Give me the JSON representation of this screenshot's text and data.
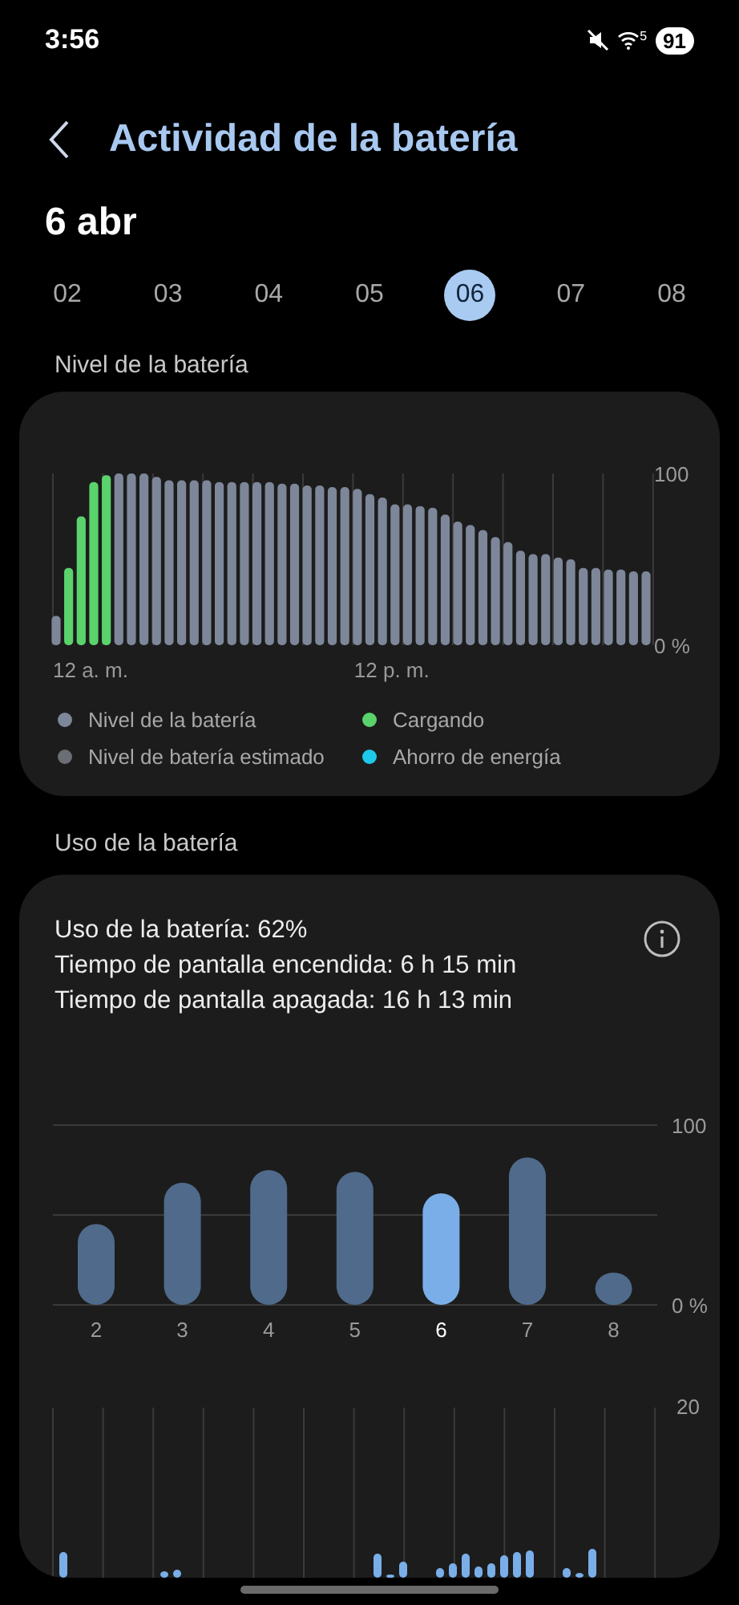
{
  "status_bar": {
    "time": "3:56",
    "wifi_label": "5",
    "battery": "91"
  },
  "header": {
    "title": "Actividad de la batería"
  },
  "date": "6 abr",
  "days": [
    {
      "label": "02",
      "selected": false
    },
    {
      "label": "03",
      "selected": false
    },
    {
      "label": "04",
      "selected": false
    },
    {
      "label": "05",
      "selected": false
    },
    {
      "label": "06",
      "selected": true
    },
    {
      "label": "07",
      "selected": false
    },
    {
      "label": "08",
      "selected": false
    }
  ],
  "level_section": {
    "title": "Nivel de la batería",
    "chart_data": {
      "type": "bar",
      "stacked": true,
      "series": [
        {
          "name": "Nivel de la batería",
          "color": "#7d8799",
          "values": [
            17,
            null,
            null,
            null,
            null,
            100,
            100,
            100,
            98,
            96,
            96,
            96,
            96,
            95,
            95,
            95,
            95,
            95,
            94,
            94,
            93,
            93,
            92,
            92,
            91,
            88,
            86,
            82,
            82,
            81,
            80,
            76,
            72,
            70,
            67,
            63,
            60,
            55,
            53,
            53,
            51,
            50,
            45,
            45,
            44,
            44,
            43,
            43
          ]
        },
        {
          "name": "Cargando",
          "color": "#5ad36c",
          "values": [
            null,
            45,
            75,
            95,
            99,
            null,
            null,
            null,
            null,
            null,
            null,
            null,
            null,
            null,
            null,
            null,
            null,
            null,
            null,
            null,
            null,
            null,
            null,
            null,
            null,
            null,
            null,
            null,
            null,
            null,
            null,
            null,
            null,
            null,
            null,
            null,
            null,
            null,
            null,
            null,
            null,
            null,
            null,
            null,
            null,
            null,
            null,
            null
          ]
        }
      ],
      "ylim": [
        0,
        100
      ],
      "yticks": [
        {
          "value": 100,
          "label": "100"
        },
        {
          "value": 0,
          "label": "0 %"
        }
      ]
    },
    "time_labels": [
      "12 a. m.",
      "12 p. m."
    ],
    "extra_legend": [
      {
        "label": "Nivel de batería estimado",
        "color": "#6b6e74"
      },
      {
        "label": "Ahorro de energía",
        "color": "#1ec8e8"
      }
    ]
  },
  "usage_section": {
    "title": "Uso de la batería",
    "summary": [
      "Uso de la batería: 62%",
      "Tiempo de pantalla encendida: 6 h 15 min",
      "Tiempo de pantalla apagada: 16 h 13 min"
    ],
    "chart_data": {
      "type": "bar",
      "stacked": true,
      "categories": [
        "2",
        "3",
        "4",
        "5",
        "6",
        "7",
        "8"
      ],
      "series": [
        {
          "color": "#4f6a8a",
          "values": [
            45,
            68,
            75,
            74,
            null,
            82,
            18
          ]
        },
        {
          "color": "#7aaee8",
          "values": [
            null,
            null,
            null,
            null,
            62,
            null,
            null
          ]
        }
      ],
      "ylim": [
        0,
        100
      ],
      "yticks": [
        {
          "value": 100,
          "label": "100"
        },
        {
          "value": 0,
          "label": "0 %"
        }
      ],
      "ref_lines": [
        {
          "axis": "y",
          "value": 50
        }
      ]
    },
    "hourly_chart": {
      "top_label": "20"
    }
  }
}
